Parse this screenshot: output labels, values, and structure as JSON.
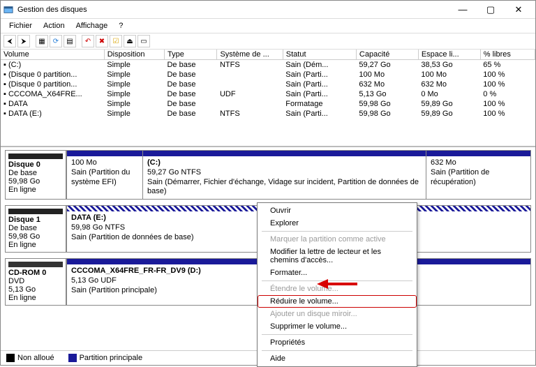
{
  "window": {
    "title": "Gestion des disques"
  },
  "menu": {
    "file": "Fichier",
    "action": "Action",
    "view": "Affichage",
    "help": "?"
  },
  "columns": {
    "volume": "Volume",
    "layout": "Disposition",
    "type": "Type",
    "fs": "Système de ...",
    "status": "Statut",
    "capacity": "Capacité",
    "free": "Espace li...",
    "pctfree": "% libres"
  },
  "volumes": [
    {
      "volume": "(C:)",
      "layout": "Simple",
      "type": "De base",
      "fs": "NTFS",
      "status": "Sain (Dém...",
      "capacity": "59,27 Go",
      "free": "38,53 Go",
      "pctfree": "65 %"
    },
    {
      "volume": "(Disque 0 partition...",
      "layout": "Simple",
      "type": "De base",
      "fs": "",
      "status": "Sain (Parti...",
      "capacity": "100 Mo",
      "free": "100 Mo",
      "pctfree": "100 %"
    },
    {
      "volume": "(Disque 0 partition...",
      "layout": "Simple",
      "type": "De base",
      "fs": "",
      "status": "Sain (Parti...",
      "capacity": "632 Mo",
      "free": "632 Mo",
      "pctfree": "100 %"
    },
    {
      "volume": "CCCOMA_X64FRE...",
      "layout": "Simple",
      "type": "De base",
      "fs": "UDF",
      "status": "Sain (Parti...",
      "capacity": "5,13 Go",
      "free": "0 Mo",
      "pctfree": "0 %"
    },
    {
      "volume": "DATA",
      "layout": "Simple",
      "type": "De base",
      "fs": "",
      "status": "Formatage",
      "capacity": "59,98 Go",
      "free": "59,89 Go",
      "pctfree": "100 %"
    },
    {
      "volume": "DATA (E:)",
      "layout": "Simple",
      "type": "De base",
      "fs": "NTFS",
      "status": "Sain (Parti...",
      "capacity": "59,98 Go",
      "free": "59,89 Go",
      "pctfree": "100 %"
    }
  ],
  "disks": {
    "d0": {
      "title": "Disque 0",
      "kind": "De base",
      "size": "59,98 Go",
      "state": "En ligne",
      "parts": [
        {
          "title": "",
          "sub": "100 Mo",
          "status": "Sain (Partition du système EFI)"
        },
        {
          "title": "(C:)",
          "sub": "59,27 Go NTFS",
          "status": "Sain (Démarrer, Fichier d'échange, Vidage sur incident, Partition de données de base)"
        },
        {
          "title": "",
          "sub": "632 Mo",
          "status": "Sain (Partition de récupération)"
        }
      ]
    },
    "d1": {
      "title": "Disque 1",
      "kind": "De base",
      "size": "59,98 Go",
      "state": "En ligne",
      "part": {
        "title": "DATA  (E:)",
        "sub": "59,98 Go NTFS",
        "status": "Sain (Partition de données de base)"
      }
    },
    "cd": {
      "title": "CD-ROM 0",
      "kind": "DVD",
      "size": "5,13 Go",
      "state": "En ligne",
      "part": {
        "title": "CCCOMA_X64FRE_FR-FR_DV9  (D:)",
        "sub": "5,13 Go UDF",
        "status": "Sain (Partition principale)"
      }
    }
  },
  "legend": {
    "unalloc": "Non alloué",
    "primary": "Partition principale"
  },
  "context_menu": {
    "open": "Ouvrir",
    "explore": "Explorer",
    "mark_active": "Marquer la partition comme active",
    "change_letter": "Modifier la lettre de lecteur et les chemins d'accès...",
    "format": "Formater...",
    "extend": "Étendre le volume...",
    "shrink": "Réduire le volume...",
    "add_mirror": "Ajouter un disque miroir...",
    "delete": "Supprimer le volume...",
    "properties": "Propriétés",
    "help": "Aide"
  }
}
